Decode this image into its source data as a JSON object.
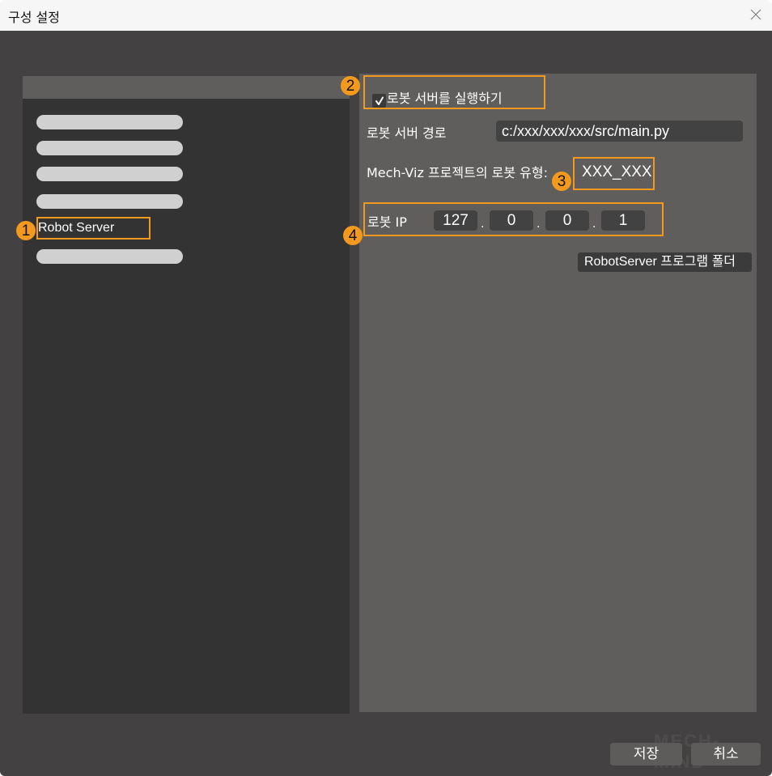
{
  "window": {
    "title": "구성 설정",
    "close_icon": "close-x-icon"
  },
  "sidebar": {
    "items": [
      {
        "label": "",
        "placeholder": true
      },
      {
        "label": "",
        "placeholder": true
      },
      {
        "label": "",
        "placeholder": true
      },
      {
        "label": "",
        "placeholder": true
      },
      {
        "label": "Robot Server",
        "placeholder": false,
        "selected": true
      },
      {
        "label": "",
        "placeholder": true
      }
    ]
  },
  "robot_server": {
    "run_checkbox": {
      "label": "로봇 서버를 실행하기",
      "checked": true
    },
    "path": {
      "label": "로봇 서버 경로",
      "value": "c:/xxx/xxx/xxx/src/main.py"
    },
    "robot_type": {
      "label": "Mech-Viz 프로젝트의 로봇 유형:",
      "value": "XXX_XXX"
    },
    "robot_ip": {
      "label": "로봇 IP",
      "octets": [
        "127",
        "0",
        "0",
        "1"
      ],
      "separator": "."
    },
    "tooltip": "RobotServer 프로그램 폴더"
  },
  "annotations": {
    "badges": [
      "1",
      "2",
      "3",
      "4"
    ],
    "color": "#f39a1e"
  },
  "footer": {
    "save_label": "저장",
    "cancel_label": "취소"
  },
  "watermark": "MECH-MIND",
  "colors": {
    "dialog_bg": "#434142",
    "left_panel_bg": "#333333",
    "right_panel_bg": "#5f5e5c",
    "input_bg": "#424242",
    "highlight": "#f39a1e"
  }
}
